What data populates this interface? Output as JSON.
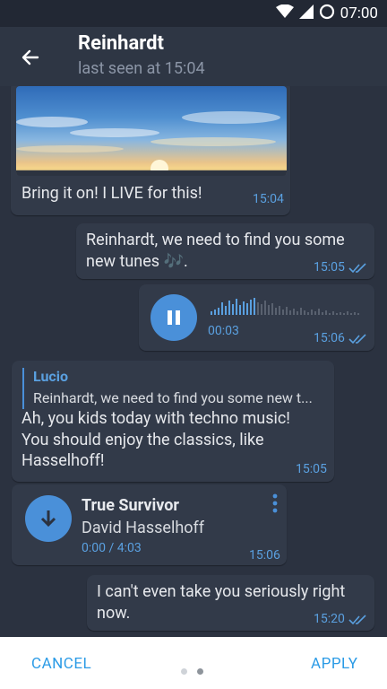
{
  "status_bar": {
    "time": "07:00"
  },
  "header": {
    "title": "Reinhardt",
    "subtitle": "last seen at 15:04"
  },
  "messages": {
    "m1": {
      "text": "Bring it on! I LIVE for this!",
      "time": "15:04"
    },
    "m2": {
      "text_line1": "Reinhardt, we need to find you some",
      "text_line2": "new tunes 🎶.",
      "time": "15:05"
    },
    "m3": {
      "duration": "00:03",
      "time": "15:06"
    },
    "m4": {
      "reply_name": "Lucio",
      "reply_text": "Reinhardt, we need to find you some new t...",
      "text_line1": "Ah, you kids today with techno music!",
      "text_line2": "You should enjoy the classics, like",
      "text_line3": "Hasselhoff!",
      "time": "15:05"
    },
    "m5": {
      "title": "True Survivor",
      "artist": "David Hasselhoff",
      "progress": "0:00 / 4:03",
      "time": "15:06"
    },
    "m6": {
      "text_line1": "I can't even take you seriously right",
      "text_line2": "now.",
      "time": "15:20"
    }
  },
  "bottom_bar": {
    "cancel_label": "CANCEL",
    "apply_label": "APPLY",
    "page_index": 2,
    "page_count": 2
  },
  "colors": {
    "accent": "#4a90d9",
    "time_text": "#5aa0e0",
    "bubble": "#323a49",
    "background": "#2b3240"
  }
}
